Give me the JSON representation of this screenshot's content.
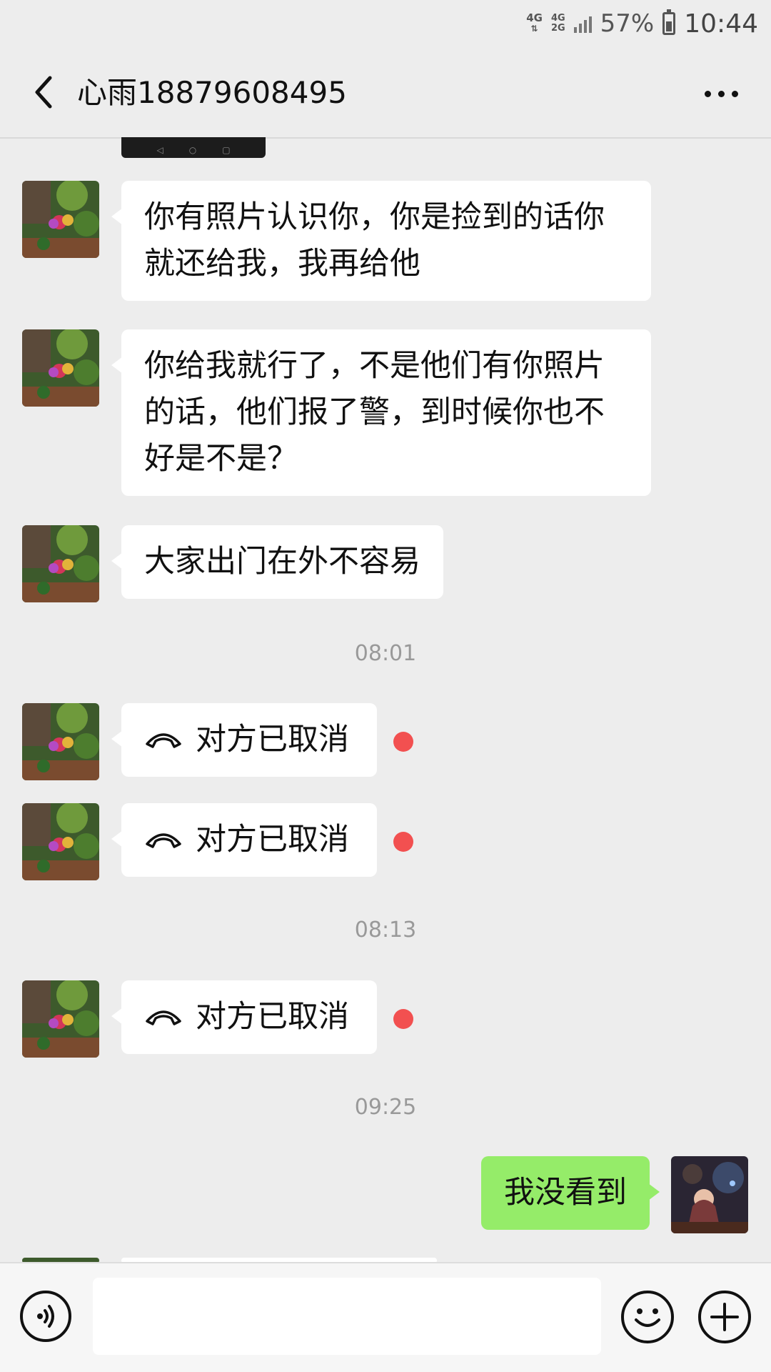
{
  "status_bar": {
    "network1": "4G",
    "network2_top": "4G",
    "network2_bottom": "2G",
    "battery_percent": "57%",
    "time": "10:44"
  },
  "header": {
    "title": "心雨18879608495",
    "back_icon": "chevron-left-icon",
    "more_icon": "more-dots-icon"
  },
  "messages": [
    {
      "sender": "other",
      "text_line1": "你有照片认识你，你是捡到的话你",
      "text_line2": "就还给我，我再给他"
    },
    {
      "sender": "other",
      "text_line1": "你给我就行了，不是他们有你照片",
      "text_line2": "的话，他们报了警，到时候你也不",
      "text_line3": "好是不是？"
    },
    {
      "sender": "other",
      "text": "大家出门在外不容易"
    }
  ],
  "timestamps": [
    "08:01",
    "08:13",
    "09:25"
  ],
  "calls": [
    {
      "text": "对方已取消",
      "icon": "phone-hangup-icon",
      "unread": true
    },
    {
      "text": "对方已取消",
      "icon": "phone-hangup-icon",
      "unread": true
    },
    {
      "text": "对方已取消",
      "icon": "phone-hangup-icon",
      "unread": true
    }
  ],
  "my_message": {
    "text": "我没看到"
  },
  "input_bar": {
    "voice_icon": "voice-icon",
    "emoji_icon": "emoji-icon",
    "plus_icon": "plus-icon",
    "input_value": ""
  },
  "colors": {
    "background": "#ededed",
    "my_bubble": "#95ec69",
    "other_bubble": "#ffffff",
    "unread_dot": "#f25050"
  }
}
